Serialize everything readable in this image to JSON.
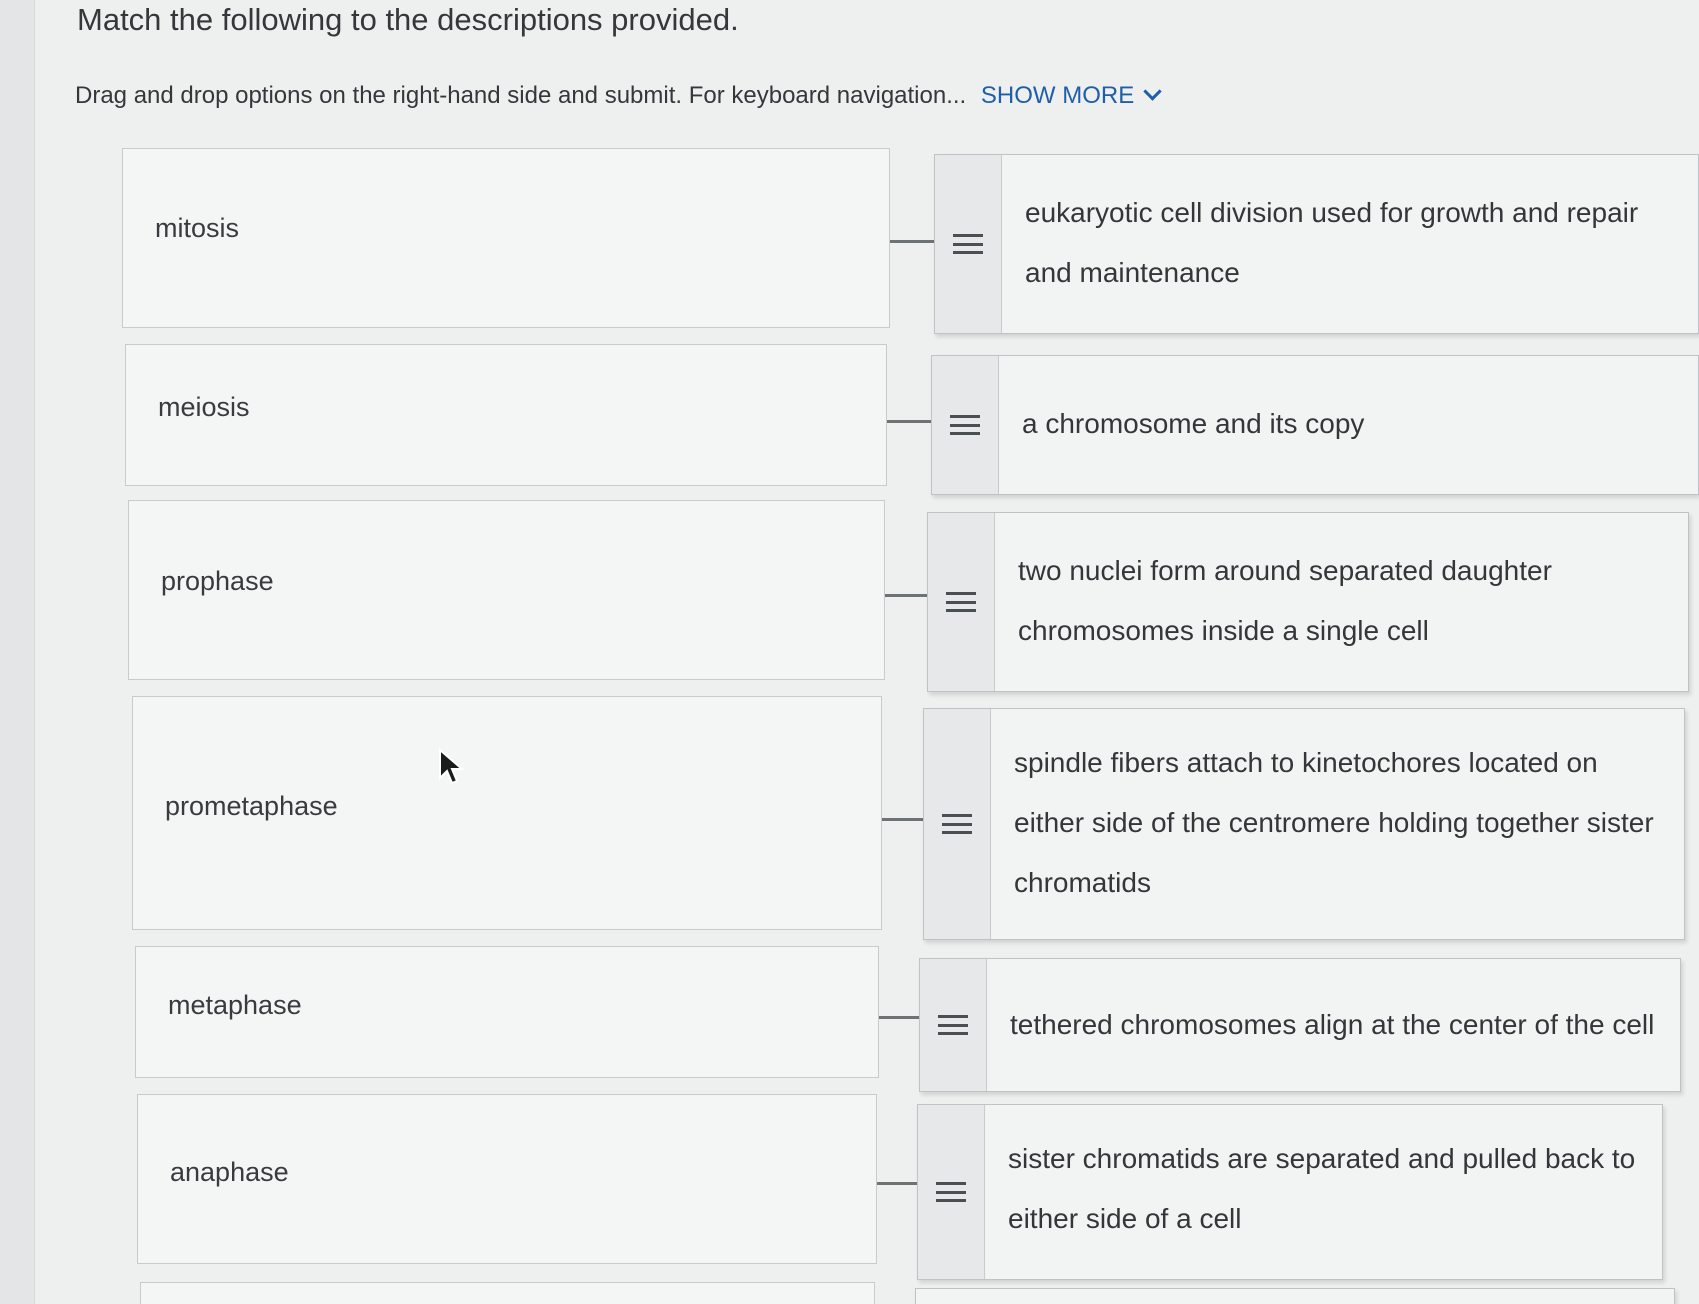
{
  "title": "Match the following to the descriptions provided.",
  "instructions": {
    "text": "Drag and drop options on the right-hand side and submit. For keyboard navigation...",
    "show_more": "SHOW MORE"
  },
  "pairs": [
    {
      "term": "mitosis",
      "description": "eukaryotic cell division used for growth and repair and maintenance"
    },
    {
      "term": "meiosis",
      "description": "a chromosome and its copy"
    },
    {
      "term": "prophase",
      "description": "two nuclei form around separated daughter chromosomes inside a single cell"
    },
    {
      "term": "prometaphase",
      "description": "spindle fibers attach to kinetochores located on either side of the centromere holding together sister chromatids"
    },
    {
      "term": "metaphase",
      "description": "tethered chromosomes align at the center of the cell"
    },
    {
      "term": "anaphase",
      "description": "sister chromatids are separated and pulled back to either side of a cell"
    }
  ]
}
